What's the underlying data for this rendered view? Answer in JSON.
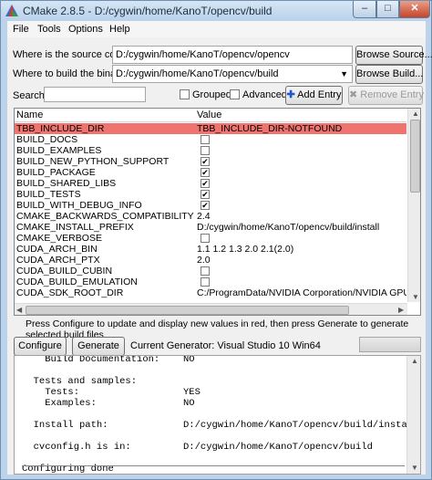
{
  "window": {
    "title": "CMake 2.8.5 - D:/cygwin/home/KanoT/opencv/build"
  },
  "titlebar_buttons": {
    "minimize": "–",
    "maximize": "□",
    "close": "✕"
  },
  "menu": [
    "File",
    "Tools",
    "Options",
    "Help"
  ],
  "source": {
    "label": "Where is the source code:",
    "value": "D:/cygwin/home/KanoT/opencv/opencv",
    "button": "Browse Source..."
  },
  "binaries": {
    "label": "Where to build the binaries:",
    "value": "D:/cygwin/home/KanoT/opencv/build",
    "button": "Browse Build..."
  },
  "search": {
    "label": "Search:",
    "value": ""
  },
  "options": {
    "grouped": "Grouped",
    "advanced": "Advanced",
    "add_entry": "Add Entry",
    "remove_entry": "Remove Entry"
  },
  "table": {
    "headers": [
      "Name",
      "Value"
    ],
    "rows": [
      {
        "name": "TBB_INCLUDE_DIR",
        "value": "TBB_INCLUDE_DIR-NOTFOUND",
        "highlight": true
      },
      {
        "name": "BUILD_DOCS",
        "checked": false
      },
      {
        "name": "BUILD_EXAMPLES",
        "checked": false
      },
      {
        "name": "BUILD_NEW_PYTHON_SUPPORT",
        "checked": true
      },
      {
        "name": "BUILD_PACKAGE",
        "checked": true
      },
      {
        "name": "BUILD_SHARED_LIBS",
        "checked": true
      },
      {
        "name": "BUILD_TESTS",
        "checked": true
      },
      {
        "name": "BUILD_WITH_DEBUG_INFO",
        "checked": true
      },
      {
        "name": "CMAKE_BACKWARDS_COMPATIBILITY",
        "value": "2.4"
      },
      {
        "name": "CMAKE_INSTALL_PREFIX",
        "value": "D:/cygwin/home/KanoT/opencv/build/install"
      },
      {
        "name": "CMAKE_VERBOSE",
        "checked": false
      },
      {
        "name": "CUDA_ARCH_BIN",
        "value": "1.1 1.2 1.3 2.0 2.1(2.0)"
      },
      {
        "name": "CUDA_ARCH_PTX",
        "value": "2.0"
      },
      {
        "name": "CUDA_BUILD_CUBIN",
        "checked": false
      },
      {
        "name": "CUDA_BUILD_EMULATION",
        "checked": false
      },
      {
        "name": "CUDA_SDK_ROOT_DIR",
        "value": "C:/ProgramData/NVIDIA Corporation/NVIDIA GPU Co"
      }
    ]
  },
  "info_text": "Press Configure to update and display new values in red, then press Generate to generate selected build files.",
  "buttons": {
    "configure": "Configure",
    "generate": "Generate"
  },
  "generator": "Current Generator: Visual Studio 10 Win64",
  "output": [
    {
      "label": "    Build Documentation:",
      "value": "NO"
    },
    {
      "label": "",
      "value": ""
    },
    {
      "label": "  Tests and samples:",
      "value": ""
    },
    {
      "label": "    Tests:",
      "value": "YES"
    },
    {
      "label": "    Examples:",
      "value": "NO"
    },
    {
      "label": "",
      "value": ""
    },
    {
      "label": "  Install path:",
      "value": "D:/cygwin/home/KanoT/opencv/build/install"
    },
    {
      "label": "",
      "value": ""
    },
    {
      "label": "  cvconfig.h is in:",
      "value": "D:/cygwin/home/KanoT/opencv/build"
    }
  ],
  "output_footer": "Configuring done"
}
